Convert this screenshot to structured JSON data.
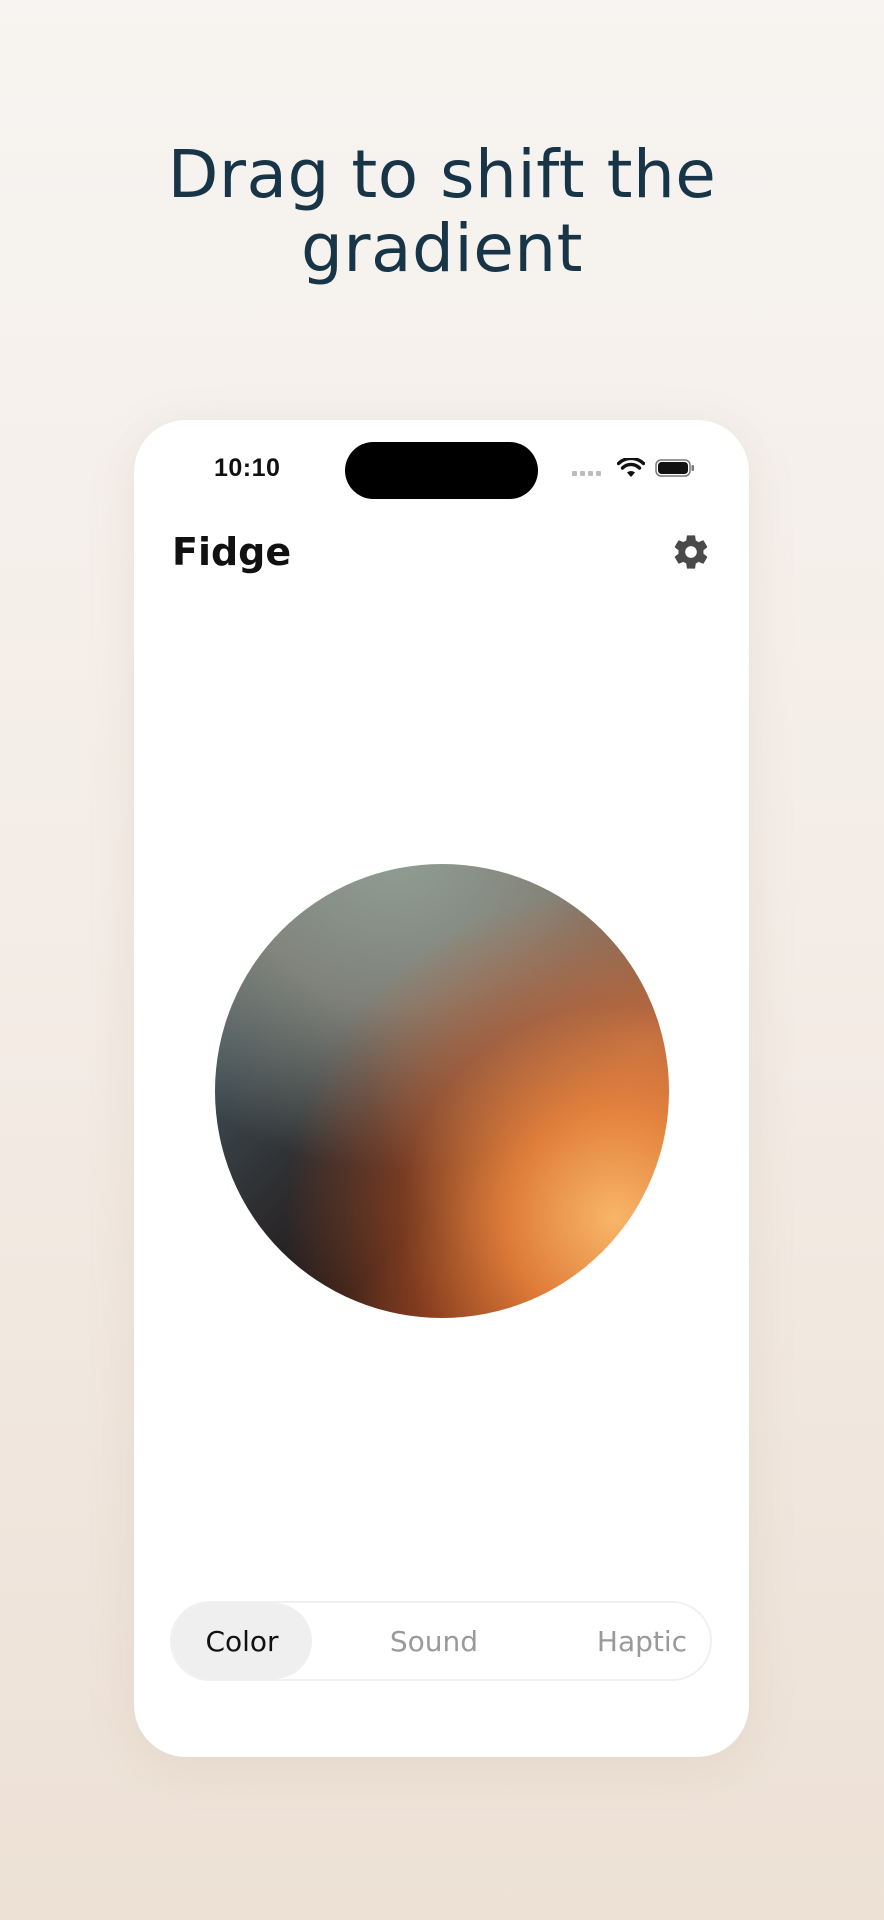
{
  "headline": {
    "line1": "Drag to shift the",
    "line2": "gradient"
  },
  "status_bar": {
    "time": "10:10"
  },
  "app": {
    "title": "Fidge"
  },
  "segments": [
    {
      "label": "Color",
      "selected": true
    },
    {
      "label": "Sound",
      "selected": false
    },
    {
      "label": "Haptic",
      "selected": false
    }
  ],
  "icons": {
    "settings": "gear-icon",
    "wifi": "wifi-icon",
    "battery": "battery-icon",
    "signal": "signal-icon"
  },
  "colors": {
    "headline": "#183548",
    "background_top": "#f7f4f1",
    "background_bottom": "#ede1d6",
    "orb_dark": "#1c1718",
    "orb_orange": "#f8b668",
    "orb_teal": "#5a7578"
  }
}
